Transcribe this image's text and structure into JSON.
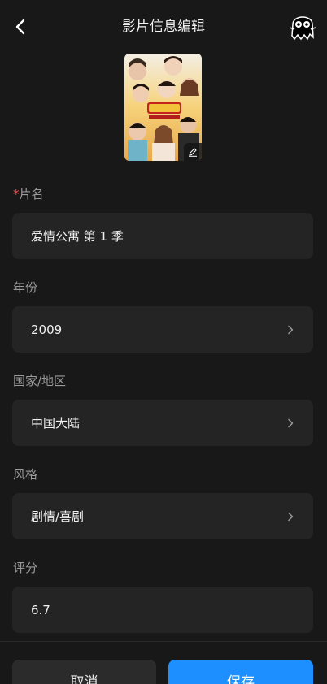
{
  "header": {
    "title": "影片信息编辑",
    "back_icon": "chevron-left-icon",
    "mascot_icon": "ghost-mascot-icon"
  },
  "poster": {
    "edit_icon": "pencil-icon"
  },
  "form": {
    "title": {
      "required_mark": "*",
      "label": "片名",
      "value": "爱情公寓 第 1 季"
    },
    "year": {
      "label": "年份",
      "value": "2009"
    },
    "country": {
      "label": "国家/地区",
      "value": "中国大陆"
    },
    "genre": {
      "label": "风格",
      "value": "剧情/喜剧"
    },
    "rating": {
      "label": "评分",
      "value": "6.7"
    }
  },
  "actions": {
    "cancel_label": "取消",
    "save_label": "保存"
  },
  "colors": {
    "background": "#181818",
    "field": "#242424",
    "accent": "#1e8fff",
    "required": "#ff4d4d"
  }
}
